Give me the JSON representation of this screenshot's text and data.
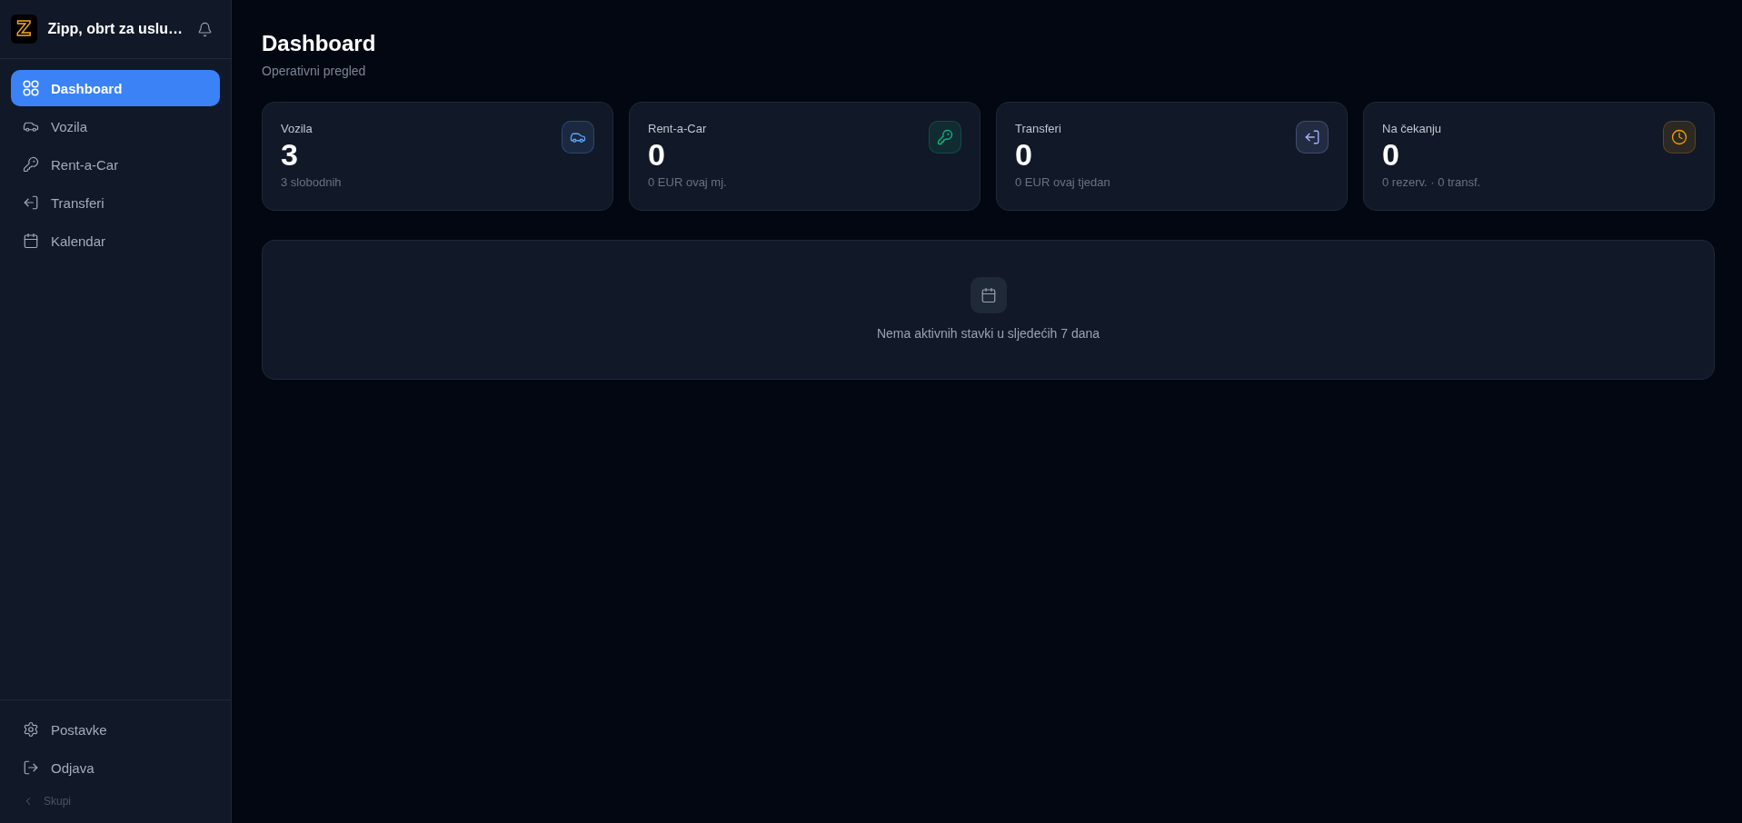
{
  "sidebar": {
    "brand": {
      "logo": "Z",
      "name": "Zipp, obrt za uslu…"
    },
    "nav": [
      {
        "label": "Dashboard",
        "selected": true
      },
      {
        "label": "Vozila",
        "selected": false
      },
      {
        "label": "Rent-a-Car",
        "selected": false
      },
      {
        "label": "Transferi",
        "selected": false
      },
      {
        "label": "Kalendar",
        "selected": false
      }
    ],
    "footer": [
      {
        "label": "Postavke"
      },
      {
        "label": "Odjava"
      }
    ],
    "collapse": {
      "label": "Skupi"
    }
  },
  "header": {
    "title": "Dashboard",
    "subtitle": "Operativni pregled"
  },
  "stats": [
    {
      "label": "Vozila",
      "value": "3",
      "note": "3 slobodnih",
      "color": "#60a5fa"
    },
    {
      "label": "Rent-a-Car",
      "value": "0",
      "note": "0 EUR ovaj mj.",
      "color": "#10b981"
    },
    {
      "label": "Transferi",
      "value": "0",
      "note": "0 EUR ovaj tjedan",
      "color": "#a5b4fc"
    },
    {
      "label": "Na čekanju",
      "value": "0",
      "note": "0 rezerv. · 0 transf.",
      "color": "#f59e0b"
    }
  ],
  "agenda": {
    "message": "Nema aktivnih stavki u sljedećih 7 dana"
  }
}
